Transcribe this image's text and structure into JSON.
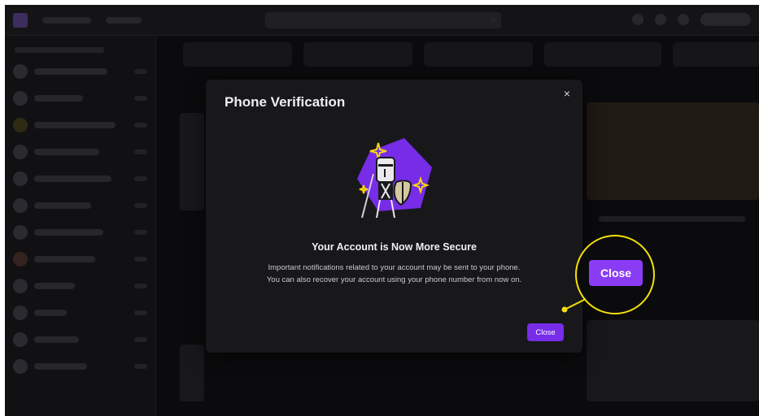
{
  "modal": {
    "title": "Phone Verification",
    "close_glyph": "×",
    "heading": "Your Account is Now More Secure",
    "body_line1": "Important notifications related to your account may be sent to your phone.",
    "body_line2": "You can also recover your account using your phone number from now on.",
    "close_label": "Close",
    "illustration": "knight-shield-icon"
  },
  "callout": {
    "label": "Close"
  },
  "colors": {
    "accent": "#772ce8",
    "callout_ring": "#f5e10a",
    "modal_bg": "#18181b",
    "backdrop": "#0b0b0d"
  },
  "icons": {
    "close": "close-icon",
    "search": "search-icon"
  }
}
